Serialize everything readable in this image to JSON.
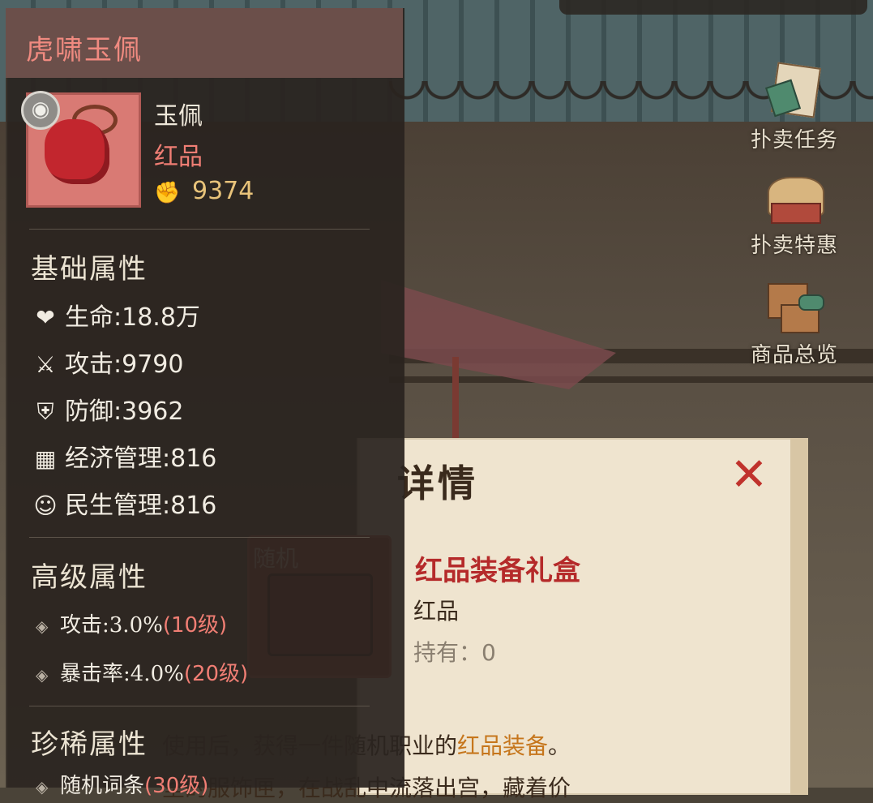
{
  "tooltip": {
    "title": "虎啸玉佩",
    "item_type": "玉佩",
    "grade": "红品",
    "power": "9374",
    "basic_section": "基础属性",
    "basic_stats": [
      {
        "icon": "heart-icon",
        "label": "生命",
        "sep": ":",
        "value": "18.8万"
      },
      {
        "icon": "sword-icon",
        "label": "攻击",
        "sep": ":",
        "value": "9790"
      },
      {
        "icon": "shield-icon",
        "label": "防御",
        "sep": ":",
        "value": "3962"
      },
      {
        "icon": "abacus-icon",
        "label": "经济管理",
        "sep": ":",
        "value": "816"
      },
      {
        "icon": "citizen-icon",
        "label": "民生管理",
        "sep": ":",
        "value": "816"
      }
    ],
    "advanced_section": "高级属性",
    "advanced_stats": [
      {
        "label": "攻击:3.0%",
        "level": "(10级)"
      },
      {
        "label": "暴击率:4.0%",
        "level": "(20级)"
      }
    ],
    "rare_section": "珍稀属性",
    "rare_stats": [
      {
        "label": "随机词条",
        "level": "(30级)"
      }
    ]
  },
  "side_menu": [
    {
      "label": "扑卖任务",
      "icon": "scroll-task-icon"
    },
    {
      "label": "扑卖特惠",
      "icon": "treasure-basket-icon"
    },
    {
      "label": "商品总览",
      "icon": "chests-icon"
    }
  ],
  "dialog": {
    "title_partial": "详情",
    "slot_tag": "随机",
    "item_name": "红品装备礼盒",
    "item_grade": "红品",
    "owned": "持有：0",
    "desc_line1_a": "使用后，获得一件随机职业的",
    "desc_line1_hl": "红品装备",
    "desc_line1_b": "。",
    "desc_line2": "室的服饰匣，在战乱中流落出宫，藏着价"
  },
  "colors": {
    "accent_red": "#f07e74",
    "panel_bg": "#2a241f",
    "header_bg": "#6b4f4a",
    "highlight_orange": "#c6761c"
  }
}
